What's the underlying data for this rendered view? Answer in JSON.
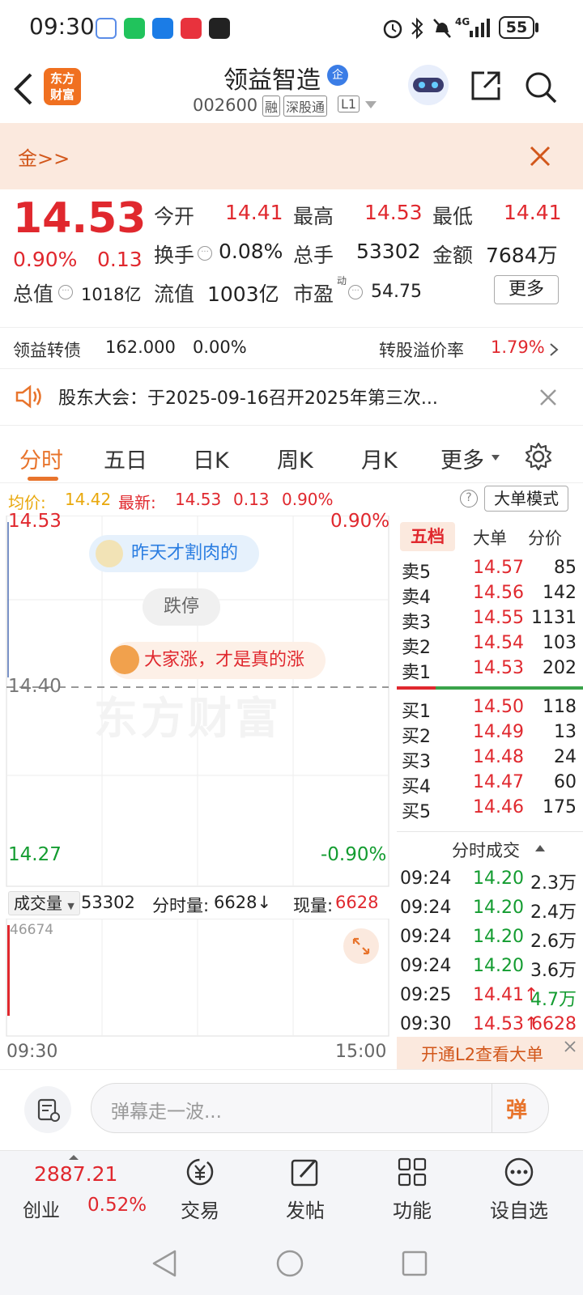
{
  "status_bar": {
    "time": "09:30",
    "battery": "55",
    "network": "4G"
  },
  "header": {
    "brand_line1": "东方",
    "brand_line2": "财富",
    "stock_name": "领益智造",
    "enterprise_badge": "企",
    "stock_code": "002600",
    "tag_margin": "融",
    "tag_connect": "深股通",
    "tag_level": "L1"
  },
  "gold_banner": {
    "text": "金>>"
  },
  "quote": {
    "price": "14.53",
    "change_pct": "0.90%",
    "change": "0.13",
    "open_label": "今开",
    "open": "14.41",
    "high_label": "最高",
    "high": "14.53",
    "low_label": "最低",
    "low": "14.41",
    "turnover_label": "换手",
    "turnover": "0.08%",
    "volume_label": "总手",
    "volume": "53302",
    "amount_label": "金额",
    "amount": "7684万",
    "mktcap_label": "总值",
    "mktcap": "1018亿",
    "float_label": "流值",
    "float": "1003亿",
    "pe_label": "市盈",
    "pe_sup": "动",
    "pe": "54.75",
    "more_button": "更多"
  },
  "bond": {
    "name": "领益转债",
    "price": "162.000",
    "pct": "0.00%",
    "premium_label": "转股溢价率",
    "premium": "1.79%"
  },
  "notice": {
    "text": "股东大会：于2025-09-16召开2025年第三次..."
  },
  "tabs": [
    "分时",
    "五日",
    "日K",
    "周K",
    "月K",
    "更多"
  ],
  "avg_line": {
    "avg_label": "均价:",
    "avg": "14.42",
    "latest_label": "最新:",
    "latest": "14.53",
    "chg": "0.13",
    "pct": "0.90%",
    "mode_button": "大单模式"
  },
  "chart": {
    "top_price": "14.53",
    "top_pct": "0.90%",
    "mid_price": "14.40",
    "bottom_price": "14.27",
    "bottom_pct": "-0.90%",
    "bubble1": "昨天才割肉的",
    "bubble2": "跌停",
    "bubble3": "大家涨，才是真的涨",
    "watermark": "东方财富"
  },
  "volume": {
    "selector": "成交量",
    "total": "53302",
    "minute_label": "分时量:",
    "minute": "6628↓",
    "now_label": "现量:",
    "now": "6628",
    "max_label": "46674",
    "start_time": "09:30",
    "end_time": "15:00"
  },
  "order_book": {
    "tabs": [
      "五档",
      "大单",
      "分价"
    ],
    "asks": [
      {
        "label": "卖5",
        "price": "14.57",
        "vol": "85"
      },
      {
        "label": "卖4",
        "price": "14.56",
        "vol": "142"
      },
      {
        "label": "卖3",
        "price": "14.55",
        "vol": "1131"
      },
      {
        "label": "卖2",
        "price": "14.54",
        "vol": "103"
      },
      {
        "label": "卖1",
        "price": "14.53",
        "vol": "202"
      }
    ],
    "bids": [
      {
        "label": "买1",
        "price": "14.50",
        "vol": "118"
      },
      {
        "label": "买2",
        "price": "14.49",
        "vol": "13"
      },
      {
        "label": "买3",
        "price": "14.48",
        "vol": "24"
      },
      {
        "label": "买4",
        "price": "14.47",
        "vol": "60"
      },
      {
        "label": "买5",
        "price": "14.46",
        "vol": "175"
      }
    ]
  },
  "ticks": {
    "title": "分时成交",
    "rows": [
      {
        "time": "09:24",
        "price": "14.20",
        "vol": "2.3万"
      },
      {
        "time": "09:24",
        "price": "14.20",
        "vol": "2.4万"
      },
      {
        "time": "09:24",
        "price": "14.20",
        "vol": "2.6万"
      },
      {
        "time": "09:24",
        "price": "14.20",
        "vol": "3.6万"
      },
      {
        "time": "09:25",
        "price": "14.41↑",
        "vol": "4.7万"
      },
      {
        "time": "09:30",
        "price": "14.53↑",
        "vol": "6628"
      }
    ]
  },
  "l2_promo": {
    "text": "开通L2查看大单"
  },
  "danmu": {
    "placeholder": "弹幕走一波...",
    "send": "弹"
  },
  "bottom_nav": {
    "index_value": "2887.21",
    "index_name": "创业",
    "index_pct": "0.52%",
    "items": [
      "交易",
      "发帖",
      "功能",
      "设自选"
    ]
  }
}
